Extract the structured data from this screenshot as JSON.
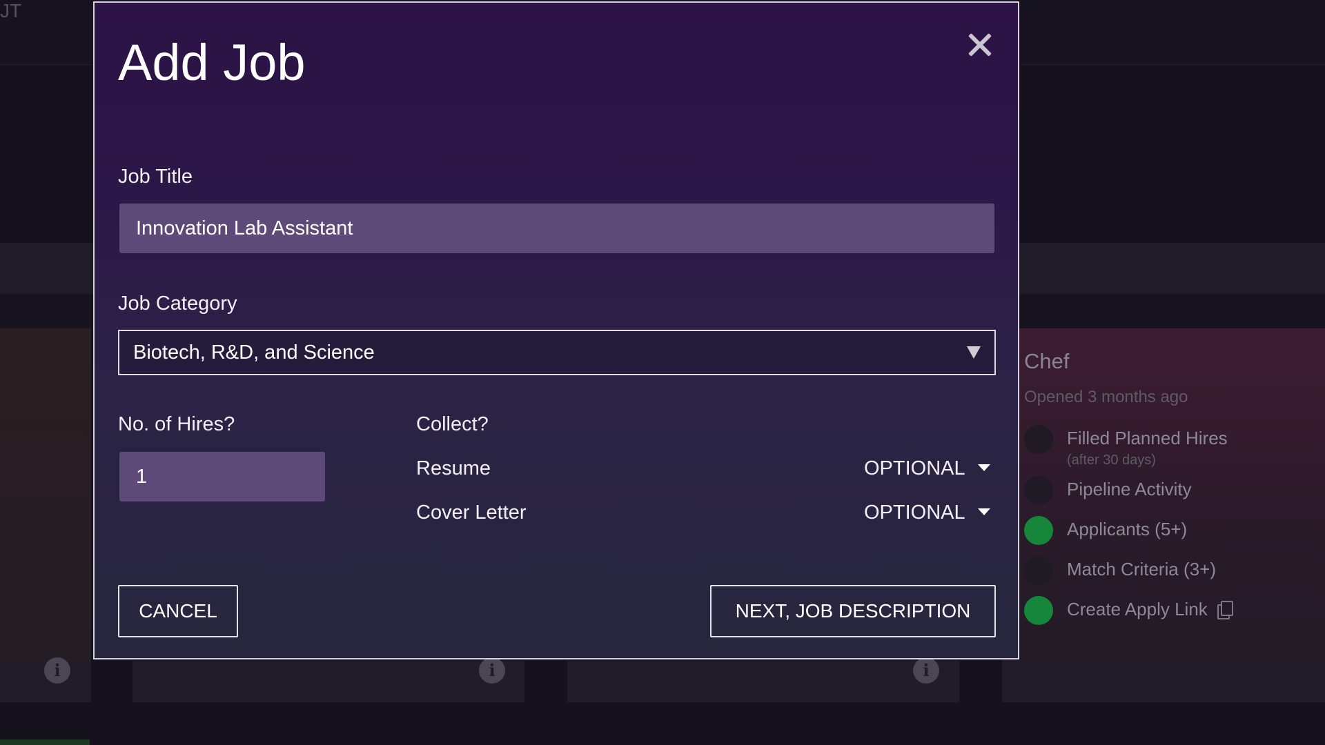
{
  "background": {
    "brand_fragment": "JT",
    "job_card": {
      "title": "Chef",
      "opened": "Opened 3 months ago",
      "criteria": [
        {
          "label": "Filled Planned Hires",
          "sub": "(after 30 days)",
          "met": false
        },
        {
          "label": "Pipeline Activity",
          "met": false
        },
        {
          "label": "Applicants (5+)",
          "met": true
        },
        {
          "label": "Match Criteria (3+)",
          "met": false
        },
        {
          "label": "Create Apply Link",
          "met": true
        }
      ]
    },
    "info_icon_glyph": "i"
  },
  "modal": {
    "title": "Add Job",
    "job_title": {
      "label": "Job Title",
      "value": "Innovation Lab Assistant"
    },
    "job_category": {
      "label": "Job Category",
      "value": "Biotech, R&D, and Science"
    },
    "hires": {
      "label": "No. of Hires?",
      "value": "1"
    },
    "collect": {
      "label": "Collect?",
      "items": [
        {
          "label": "Resume",
          "value": "OPTIONAL"
        },
        {
          "label": "Cover Letter",
          "value": "OPTIONAL"
        }
      ]
    },
    "cancel_label": "CANCEL",
    "next_label": "NEXT, JOB DESCRIPTION"
  },
  "colors": {
    "success_dot": "#16863a",
    "modal_border": "#d6d3dc",
    "input_fill": "#5e4a79"
  }
}
